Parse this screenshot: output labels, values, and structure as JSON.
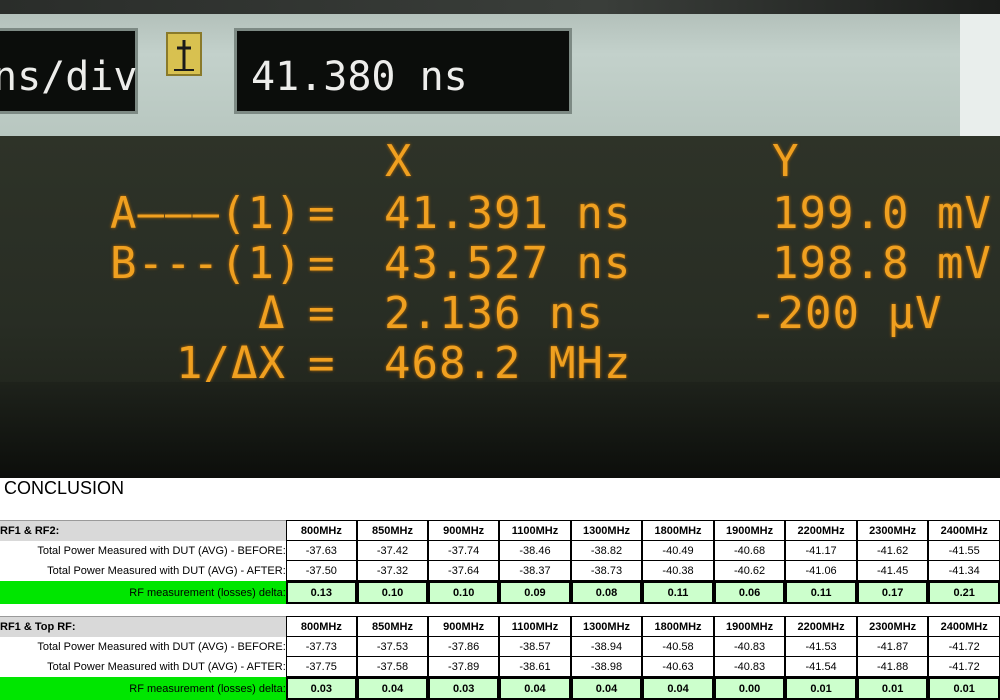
{
  "scope": {
    "timebase_value": "ns/div",
    "position_value": "41.380 ns",
    "header_x": "X",
    "header_y": "Y",
    "rows": [
      {
        "label": "A———(1)",
        "eq": "=",
        "x": "41.391 ns",
        "y": "199.0 mV"
      },
      {
        "label": "B---(1)",
        "eq": "=",
        "x": "43.527 ns",
        "y": "198.8 mV"
      },
      {
        "label": "Δ",
        "eq": "=",
        "x": "2.136 ns",
        "y": "-200 µV"
      },
      {
        "label": "1/ΔX",
        "eq": "=",
        "x": "468.2 MHz",
        "y": ""
      }
    ]
  },
  "conclusion": {
    "title": "CONCLUSION",
    "frequencies": [
      "800MHz",
      "850MHz",
      "900MHz",
      "1100MHz",
      "1300MHz",
      "1800MHz",
      "1900MHz",
      "2200MHz",
      "2300MHz",
      "2400MHz"
    ],
    "sections": [
      {
        "name": "RF1 & RF2:",
        "before_label": "Total Power Measured with DUT (AVG) - BEFORE:",
        "after_label": "Total Power Measured with DUT (AVG) - AFTER:",
        "delta_label": "RF measurement (losses) delta:",
        "before": [
          "-37.63",
          "-37.42",
          "-37.74",
          "-38.46",
          "-38.82",
          "-40.49",
          "-40.68",
          "-41.17",
          "-41.62",
          "-41.55"
        ],
        "after": [
          "-37.50",
          "-37.32",
          "-37.64",
          "-38.37",
          "-38.73",
          "-40.38",
          "-40.62",
          "-41.06",
          "-41.45",
          "-41.34"
        ],
        "delta": [
          "0.13",
          "0.10",
          "0.10",
          "0.09",
          "0.08",
          "0.11",
          "0.06",
          "0.11",
          "0.17",
          "0.21"
        ]
      },
      {
        "name": "RF1 & Top RF:",
        "before_label": "Total Power Measured with DUT (AVG) - BEFORE:",
        "after_label": "Total Power Measured with DUT (AVG) - AFTER:",
        "delta_label": "RF measurement (losses) delta:",
        "before": [
          "-37.73",
          "-37.53",
          "-37.86",
          "-38.57",
          "-38.94",
          "-40.58",
          "-40.83",
          "-41.53",
          "-41.87",
          "-41.72"
        ],
        "after": [
          "-37.75",
          "-37.58",
          "-37.89",
          "-38.61",
          "-38.98",
          "-40.63",
          "-40.83",
          "-41.54",
          "-41.88",
          "-41.72"
        ],
        "delta": [
          "0.03",
          "0.04",
          "0.03",
          "0.04",
          "0.04",
          "0.04",
          "0.00",
          "0.01",
          "0.01",
          "0.01"
        ]
      }
    ]
  },
  "colors": {
    "delta_row_highlight": "#00e600",
    "delta_cell_fill": "#ccffcc",
    "scope_text": "#f0a020",
    "section_header_fill": "#d9d9d9"
  }
}
